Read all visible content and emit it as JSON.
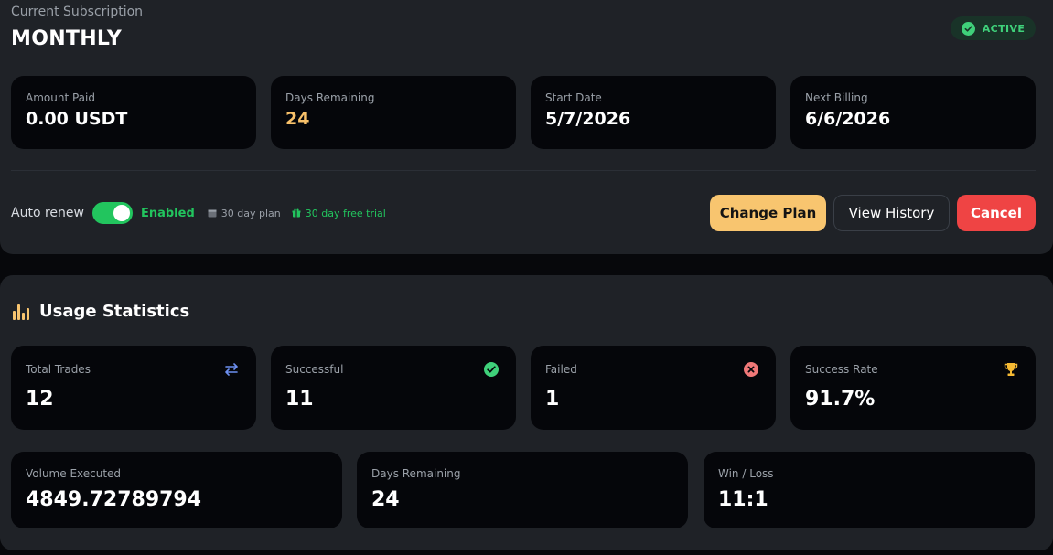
{
  "subscription": {
    "caption": "Current Subscription",
    "plan_name": "MONTHLY",
    "status": "ACTIVE",
    "cards": [
      {
        "label": "Amount Paid",
        "value": "0.00 USDT"
      },
      {
        "label": "Days Remaining",
        "value": "24"
      },
      {
        "label": "Start Date",
        "value": "5/7/2026"
      },
      {
        "label": "Next Billing",
        "value": "6/6/2026"
      }
    ],
    "auto_renew_label": "Auto renew",
    "auto_renew_on": true,
    "auto_renew_state": "Enabled",
    "plan_length": "30 day plan",
    "trial": "30 day free trial",
    "buttons": {
      "change_plan": "Change Plan",
      "view_history": "View History",
      "cancel": "Cancel"
    }
  },
  "usage": {
    "title": "Usage Statistics",
    "cards": [
      {
        "label": "Total Trades",
        "value": "12",
        "icon": "swap-arrows-icon"
      },
      {
        "label": "Successful",
        "value": "11",
        "icon": "check-circle-icon"
      },
      {
        "label": "Failed",
        "value": "1",
        "icon": "x-circle-icon"
      },
      {
        "label": "Success Rate",
        "value": "91.7%",
        "icon": "trophy-icon"
      }
    ],
    "wide_cards": [
      {
        "label": "Volume Executed",
        "value": "4849.72789794"
      },
      {
        "label": "Days Remaining",
        "value": "24"
      },
      {
        "label": "Win / Loss",
        "value": "11:1"
      }
    ]
  },
  "colors": {
    "accent_orange": "#f8c56f",
    "active_green": "#22c55e",
    "danger_red": "#ef4444",
    "panel_bg": "#1f2227",
    "card_bg": "#05060a"
  }
}
